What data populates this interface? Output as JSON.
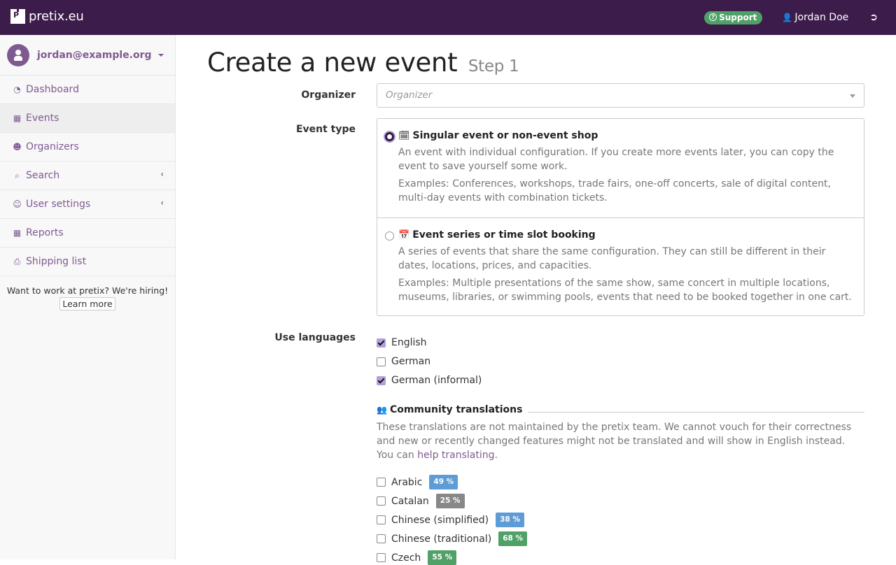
{
  "topbar": {
    "brand": "pretix.eu",
    "support_label": "Support",
    "user_name": "Jordan Doe",
    "icons": {
      "support": "question-circle-icon",
      "user": "user-icon",
      "logout": "sign-out-icon"
    }
  },
  "sidebar": {
    "account_email": "jordan@example.org",
    "items": [
      {
        "label": "Dashboard",
        "icon": "dashboard-icon",
        "active": false,
        "has_chevron": false
      },
      {
        "label": "Events",
        "icon": "calendar-icon",
        "active": true,
        "has_chevron": false
      },
      {
        "label": "Organizers",
        "icon": "group-icon",
        "active": false,
        "has_chevron": false
      },
      {
        "label": "Search",
        "icon": "search-icon",
        "active": false,
        "has_chevron": true
      },
      {
        "label": "User settings",
        "icon": "user-icon",
        "active": false,
        "has_chevron": true
      },
      {
        "label": "Reports",
        "icon": "table-icon",
        "active": false,
        "has_chevron": false
      },
      {
        "label": "Shipping list",
        "icon": "print-icon",
        "active": false,
        "has_chevron": false
      }
    ],
    "hiring_text": "Want to work at pretix? We're hiring!",
    "learn_more_label": "Learn more"
  },
  "main": {
    "title": "Create a new event",
    "step": "Step 1",
    "organizer": {
      "label": "Organizer",
      "placeholder": "Organizer",
      "value": ""
    },
    "event_type": {
      "label": "Event type",
      "options": [
        {
          "title": "Singular event or non-event shop",
          "icon": "calendar-o-icon",
          "checked": true,
          "description": "An event with individual configuration. If you create more events later, you can copy the event to save yourself some work.",
          "examples": "Examples: Conferences, workshops, trade fairs, one-off concerts, sale of digital content, multi-day events with combination tickets."
        },
        {
          "title": "Event series or time slot booking",
          "icon": "calendar-icon",
          "checked": false,
          "description": "A series of events that share the same configuration. They can still be different in their dates, locations, prices, and capacities.",
          "examples": "Examples: Multiple presentations of the same show, same concert in multiple locations, museums, libraries, or swimming pools, events that need to be booked together in one cart."
        }
      ]
    },
    "languages": {
      "label": "Use languages",
      "items": [
        {
          "label": "English",
          "checked": true
        },
        {
          "label": "German",
          "checked": false
        },
        {
          "label": "German (informal)",
          "checked": true
        }
      ]
    },
    "community": {
      "heading": "Community translations",
      "text_before_link": "These translations are not maintained by the pretix team. We cannot vouch for their correctness and new or recently changed features might not be translated and will show in English instead. You can ",
      "link_text": "help translating",
      "text_after_link": ".",
      "items": [
        {
          "label": "Arabic",
          "checked": false,
          "percent": "49 %",
          "color": "#5d9cd5"
        },
        {
          "label": "Catalan",
          "checked": false,
          "percent": "25 %",
          "color": "#888888"
        },
        {
          "label": "Chinese (simplified)",
          "checked": false,
          "percent": "38 %",
          "color": "#5d9cd5"
        },
        {
          "label": "Chinese (traditional)",
          "checked": false,
          "percent": "68 %",
          "color": "#50a167"
        },
        {
          "label": "Czech",
          "checked": false,
          "percent": "55 %",
          "color": "#50a167"
        }
      ]
    }
  },
  "colors": {
    "topbar": "#3b1c4a",
    "brand_purple": "#7f5a91",
    "support_green": "#50a167",
    "checkbox_checked": "#b29fd9"
  }
}
